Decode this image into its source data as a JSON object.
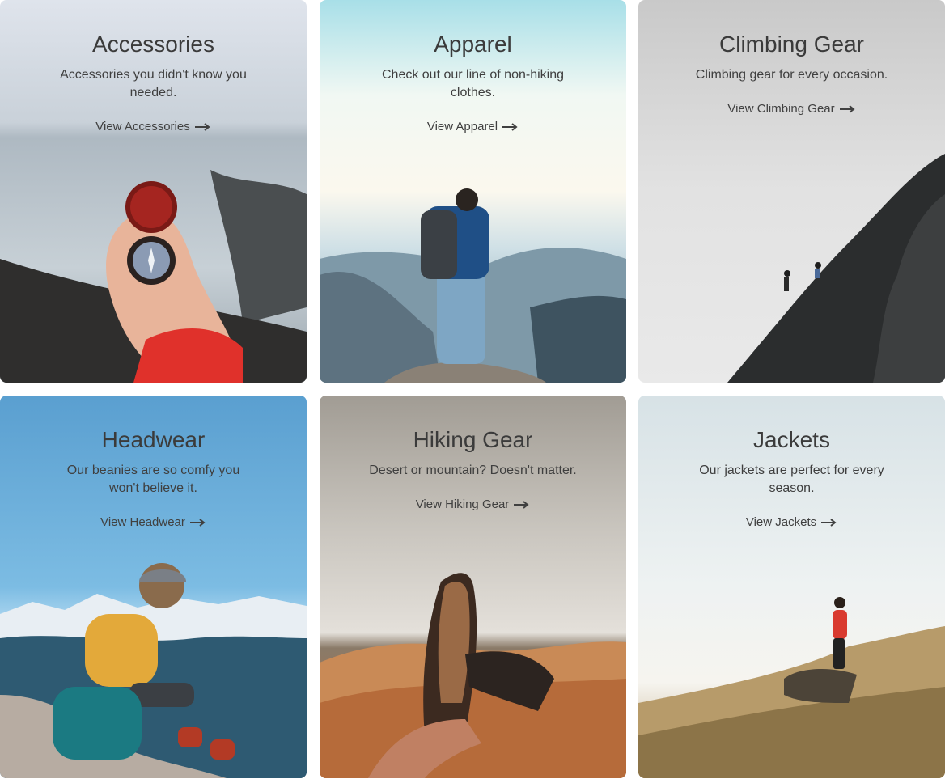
{
  "cards": [
    {
      "title": "Accessories",
      "description": "Accessories you didn't know you needed.",
      "link_label": "View Accessories"
    },
    {
      "title": "Apparel",
      "description": "Check out our line of non-hiking clothes.",
      "link_label": "View Apparel"
    },
    {
      "title": "Climbing Gear",
      "description": "Climbing gear for every occasion.",
      "link_label": "View Climbing Gear"
    },
    {
      "title": "Headwear",
      "description": "Our beanies are so comfy you won't believe it.",
      "link_label": "View Headwear"
    },
    {
      "title": "Hiking Gear",
      "description": "Desert or mountain? Doesn't matter.",
      "link_label": "View Hiking Gear"
    },
    {
      "title": "Jackets",
      "description": "Our jackets are perfect for every season.",
      "link_label": "View Jackets"
    }
  ],
  "icons": {
    "link_arrow": "arrow-right-icon"
  },
  "colors": {
    "text": "#3f3f3f",
    "heading": "#3b3b3b"
  }
}
